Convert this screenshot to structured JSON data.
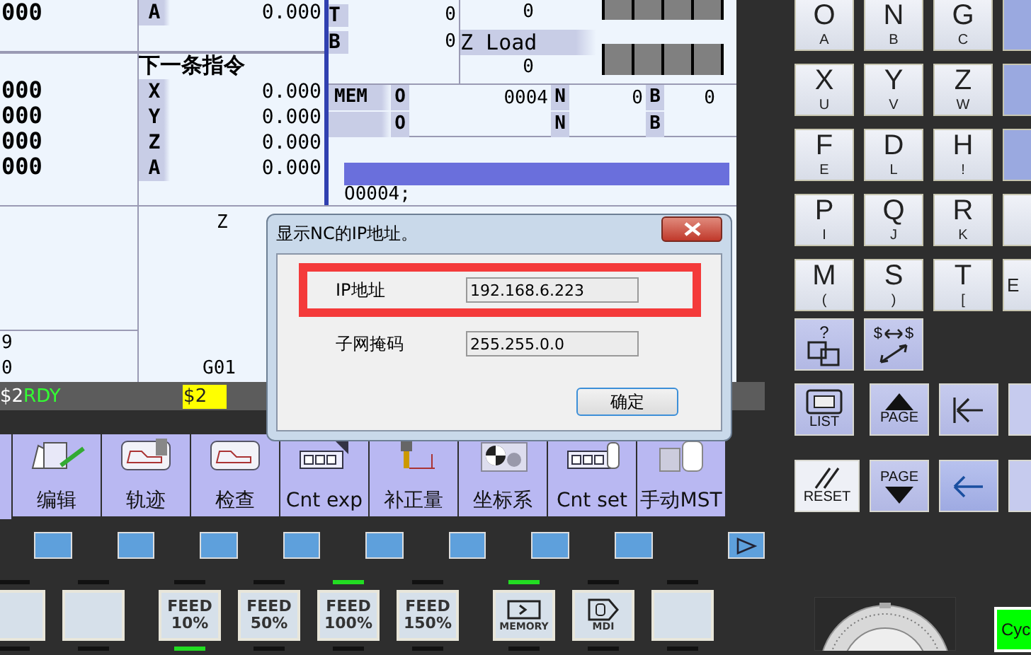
{
  "screen": {
    "left_values": [
      "000",
      "000",
      "000",
      "000",
      "000"
    ],
    "current_axis": {
      "axis": "A",
      "value": "0.000"
    },
    "next_command": {
      "title": "下一条指令",
      "axes": [
        {
          "axis": "X",
          "value": "0.000"
        },
        {
          "axis": "Y",
          "value": "0.000"
        },
        {
          "axis": "Z",
          "value": "0.000"
        },
        {
          "axis": "A",
          "value": "0.000"
        }
      ]
    },
    "spindle": [
      {
        "label": "T",
        "value": "0"
      },
      {
        "label": "B",
        "value": "0"
      }
    ],
    "load": [
      {
        "value": "0"
      },
      {
        "label": "Z Load",
        "value": "0"
      }
    ],
    "program_status": [
      {
        "mode": "MEM",
        "fields": [
          {
            "label": "O",
            "value": "0004"
          },
          {
            "label": "N",
            "value": "0"
          },
          {
            "label": "B",
            "value": "0"
          }
        ]
      },
      {
        "fields": [
          {
            "label": "O"
          },
          {
            "label": "N"
          },
          {
            "label": "B"
          }
        ]
      }
    ],
    "program_text": "O0004;",
    "lower": {
      "axis_label": "Z",
      "lines": [
        "9",
        "0"
      ],
      "modal": "G01"
    }
  },
  "status_bar": {
    "system": "$2",
    "state": "RDY",
    "selected_system": "$2"
  },
  "softkeys": [
    {
      "label": "编辑",
      "kind": "edit"
    },
    {
      "label": "轨迹",
      "kind": "path"
    },
    {
      "label": "检查",
      "kind": "check"
    },
    {
      "label": "Cnt exp",
      "kind": "counter"
    },
    {
      "label": "补正量",
      "kind": "offset"
    },
    {
      "label": "坐标系",
      "kind": "coord"
    },
    {
      "label": "Cnt set",
      "kind": "counter-hand"
    },
    {
      "label": "手动MST",
      "kind": "manual"
    }
  ],
  "function_keys": [
    {
      "kind": "blank"
    },
    {
      "kind": "blank"
    },
    {
      "kind": "blank"
    },
    {
      "kind": "blank"
    },
    {
      "kind": "blank"
    },
    {
      "kind": "blank"
    },
    {
      "kind": "blank"
    },
    {
      "kind": "blank"
    },
    {
      "kind": "next"
    }
  ],
  "panel_buttons": [
    {
      "kind": "blank",
      "lamp_top": false,
      "lamp_bottom": false
    },
    {
      "kind": "blank",
      "lamp_top": false,
      "lamp_bottom": false
    },
    {
      "kind": "feed",
      "label": "FEED",
      "value": "10%",
      "lamp_top": false,
      "lamp_bottom": true
    },
    {
      "kind": "feed",
      "label": "FEED",
      "value": "50%",
      "lamp_top": false,
      "lamp_bottom": false
    },
    {
      "kind": "feed",
      "label": "FEED",
      "value": "100%",
      "lamp_top": true,
      "lamp_bottom": false
    },
    {
      "kind": "feed",
      "label": "FEED",
      "value": "150%",
      "lamp_top": false,
      "lamp_bottom": false
    },
    {
      "kind": "memory",
      "label": "MEMORY",
      "lamp_top": true,
      "lamp_bottom": false
    },
    {
      "kind": "mdi",
      "label": "MDI",
      "lamp_top": false,
      "lamp_bottom": false
    },
    {
      "kind": "blank",
      "lamp_top": false,
      "lamp_bottom": false
    }
  ],
  "keypad": [
    {
      "main": "O",
      "sub": "A"
    },
    {
      "main": "N",
      "sub": "B"
    },
    {
      "main": "G",
      "sub": "C"
    },
    {
      "kind": "blue"
    },
    {
      "main": "X",
      "sub": "U"
    },
    {
      "main": "Y",
      "sub": "V"
    },
    {
      "main": "Z",
      "sub": "W"
    },
    {
      "kind": "blue"
    },
    {
      "main": "F",
      "sub": "E"
    },
    {
      "main": "D",
      "sub": "L"
    },
    {
      "main": "H",
      "sub": "!"
    },
    {
      "kind": "blue"
    },
    {
      "main": "P",
      "sub": "I"
    },
    {
      "main": "Q",
      "sub": "J"
    },
    {
      "main": "R",
      "sub": "K"
    },
    {
      "kind": "light"
    },
    {
      "main": "M",
      "sub": "("
    },
    {
      "main": "S",
      "sub": ")"
    },
    {
      "main": "T",
      "sub": "["
    },
    {
      "kind": "light",
      "label": "E"
    }
  ],
  "nav_rows": [
    [
      {
        "kind": "help",
        "label": "?"
      },
      {
        "kind": "switch",
        "label": "$",
        "label2": "$"
      }
    ],
    [
      {
        "kind": "list",
        "label": "LIST"
      },
      {
        "kind": "page-up",
        "label": "PAGE"
      },
      {
        "kind": "home"
      },
      {
        "kind": "up"
      }
    ],
    [
      {
        "kind": "reset",
        "label": "RESET"
      },
      {
        "kind": "page-down",
        "label": "PAGE"
      },
      {
        "kind": "left"
      },
      {
        "kind": "down"
      }
    ]
  ],
  "cycle_start": {
    "label": "Cyc"
  },
  "dialog": {
    "title": "显示NC的IP地址。",
    "fields": [
      {
        "label": "IP地址",
        "value": "192.168.6.223",
        "highlighted": true
      },
      {
        "label": "子网掩码",
        "value": "255.255.0.0",
        "highlighted": false
      }
    ],
    "ok_button": "确定"
  }
}
